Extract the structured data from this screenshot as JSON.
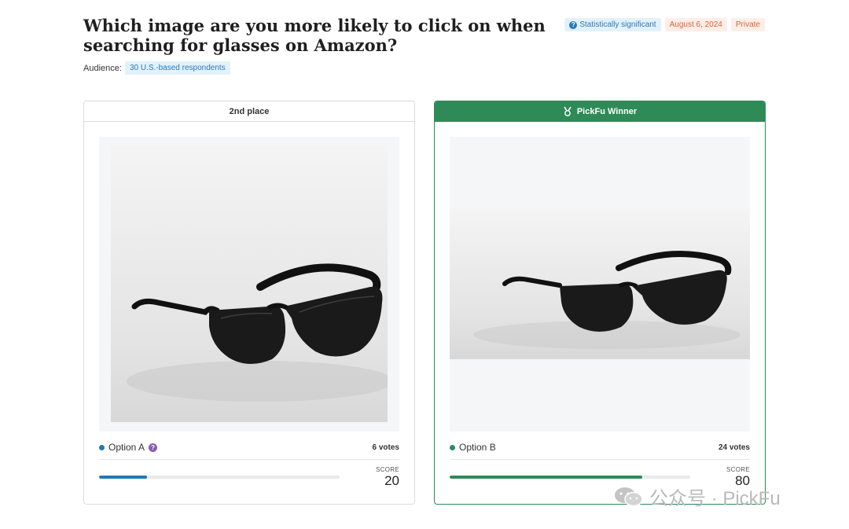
{
  "question": "Which image are you more likely to click on when searching for glasses on Amazon?",
  "badges": {
    "significance": "Statistically significant",
    "date": "August 6, 2024",
    "privacy": "Private"
  },
  "audience": {
    "label": "Audience:",
    "tag": "30 U.S.-based respondents"
  },
  "options": [
    {
      "header": "2nd place",
      "name": "Option A",
      "help_icon": "question-icon",
      "votes": "6 votes",
      "score_label": "SCORE",
      "score": "20",
      "score_fraction": 0.2,
      "color": "#1f7ab5"
    },
    {
      "header": "PickFu Winner",
      "header_icon": "medal-icon",
      "name": "Option B",
      "votes": "24 votes",
      "score_label": "SCORE",
      "score": "80",
      "score_fraction": 0.8,
      "color": "#2e8b57"
    }
  ],
  "watermark": "公众号 · PickFu"
}
